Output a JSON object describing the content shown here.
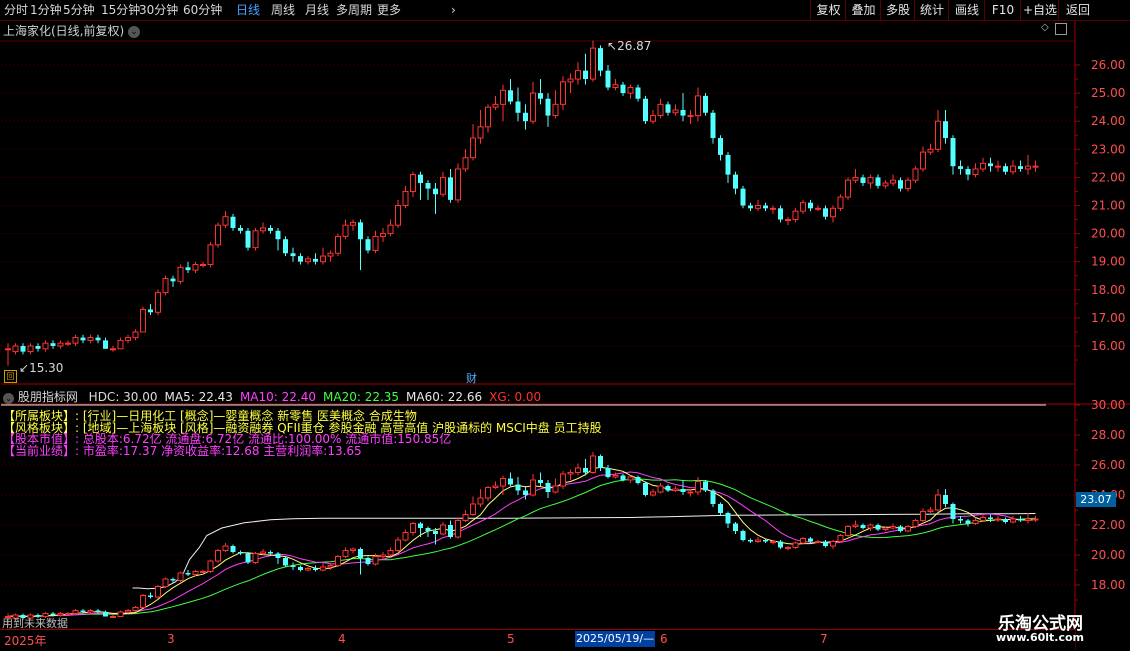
{
  "toolbar": {
    "periods": [
      "分时",
      "1分钟",
      "5分钟",
      "15分钟",
      "30分钟",
      "60分钟",
      "日线",
      "周线",
      "月线",
      "多周期",
      "更多"
    ],
    "active_period": "日线",
    "right_buttons": [
      "复权",
      "叠加",
      "多股",
      "统计",
      "画线",
      "F10",
      "+自选",
      "返回"
    ],
    "mark_label": "标记"
  },
  "main_panel": {
    "title": "上海家化(日线,前复权)",
    "high_label": "26.87",
    "low_label": "15.30",
    "fin_marker": "财",
    "y_ticks": [
      "26.00",
      "25.00",
      "24.00",
      "23.00",
      "22.00",
      "21.00",
      "20.00",
      "19.00",
      "18.00",
      "17.00",
      "16.00"
    ]
  },
  "indicator_panel": {
    "name": "股朋指标网",
    "readouts": [
      {
        "label": "HDC: 30.00",
        "color": "#dcdcdc"
      },
      {
        "label": "MA5: 22.43",
        "color": "#e8e8e8"
      },
      {
        "label": "MA10: 22.40",
        "color": "#ff40ff"
      },
      {
        "label": "MA20: 22.35",
        "color": "#40ff40"
      },
      {
        "label": "MA60: 22.66",
        "color": "#e8e8e8"
      },
      {
        "label": "XG: 0.00",
        "color": "#ff3030"
      }
    ],
    "info_lines": [
      {
        "text": "【所属板块】: [行业]—日用化工 [概念]—婴童概念 新零售 医美概念 合成生物",
        "color": "#ffff40"
      },
      {
        "text": "【风格板块】: [地域]—上海板块 [风格]—融资融券 QFII重仓 参股金融 高营高值 沪股通标的 MSCI中盘 员工持股",
        "color": "#ffff40"
      },
      {
        "text": "【股本市值】: 总股本:6.72亿 流通盘:6.72亿 流通比:100.00% 流通市值:150.85亿",
        "color": "#ff40ff"
      },
      {
        "text": "【当前业绩】: 市盈率:17.37 净资收益率:12.68 主营利润率:13.65",
        "color": "#ff40ff"
      }
    ],
    "current_price": "23.07",
    "y_ticks": [
      "30.00",
      "28.00",
      "26.00",
      "24.00",
      "22.00",
      "20.00",
      "18.00"
    ],
    "footer_note": "用到未来数据"
  },
  "time_axis": {
    "year": "2025年",
    "months": [
      "3",
      "4",
      "5",
      "6",
      "7"
    ],
    "cursor_date": "2025/05/19/—"
  },
  "watermark": {
    "site": "乐淘公式网",
    "url": "www.60lt.com"
  },
  "colors": {
    "up": "#ff3232",
    "down": "#54ffff",
    "axis": "#a00000",
    "grid": "#5a0000",
    "ma5": "#ffffff",
    "ma10": "#ff40ff",
    "ma20": "#40ff40",
    "ma60": "#ffffff",
    "price_box": "#0060a0"
  },
  "chart_data": {
    "type": "candlestick",
    "axis_range_main": [
      15.3,
      26.87
    ],
    "axis_range_indicator": [
      17.5,
      30
    ],
    "candles": [
      [
        15.9,
        15.9,
        16.1,
        15.3
      ],
      [
        15.8,
        16.0,
        16.1,
        15.7
      ],
      [
        16.0,
        15.8,
        16.1,
        15.7
      ],
      [
        15.8,
        16.0,
        16.1,
        15.7
      ],
      [
        16.0,
        15.9,
        16.1,
        15.8
      ],
      [
        15.9,
        16.1,
        16.2,
        15.8
      ],
      [
        16.1,
        16.0,
        16.2,
        15.9
      ],
      [
        16.0,
        16.1,
        16.2,
        15.9
      ],
      [
        16.1,
        16.1,
        16.2,
        16.0
      ],
      [
        16.1,
        16.3,
        16.4,
        16.0
      ],
      [
        16.3,
        16.2,
        16.4,
        16.1
      ],
      [
        16.2,
        16.3,
        16.4,
        16.1
      ],
      [
        16.3,
        16.2,
        16.4,
        16.1
      ],
      [
        16.2,
        15.9,
        16.3,
        15.9
      ],
      [
        15.9,
        15.9,
        16.0,
        15.8
      ],
      [
        15.9,
        16.2,
        16.3,
        15.9
      ],
      [
        16.2,
        16.3,
        16.4,
        16.1
      ],
      [
        16.3,
        16.5,
        16.6,
        16.2
      ],
      [
        16.5,
        17.3,
        17.4,
        16.5
      ],
      [
        17.3,
        17.2,
        17.5,
        17.1
      ],
      [
        17.2,
        17.9,
        18.0,
        17.1
      ],
      [
        17.9,
        18.4,
        18.5,
        17.8
      ],
      [
        18.4,
        18.3,
        18.5,
        18.1
      ],
      [
        18.3,
        18.8,
        18.9,
        18.2
      ],
      [
        18.8,
        18.7,
        19.0,
        18.6
      ],
      [
        18.7,
        18.9,
        19.0,
        18.6
      ],
      [
        18.9,
        18.9,
        19.0,
        18.8
      ],
      [
        18.9,
        19.6,
        19.7,
        18.8
      ],
      [
        19.6,
        20.3,
        20.4,
        19.5
      ],
      [
        20.3,
        20.6,
        20.8,
        20.2
      ],
      [
        20.6,
        20.2,
        20.7,
        20.1
      ],
      [
        20.2,
        20.1,
        20.3,
        20.0
      ],
      [
        20.1,
        19.5,
        20.2,
        19.4
      ],
      [
        19.5,
        20.1,
        20.2,
        19.4
      ],
      [
        20.1,
        20.2,
        20.4,
        20.0
      ],
      [
        20.2,
        20.1,
        20.3,
        20.0
      ],
      [
        20.1,
        19.8,
        20.2,
        19.4
      ],
      [
        19.8,
        19.3,
        19.9,
        19.2
      ],
      [
        19.3,
        19.2,
        19.5,
        19.0
      ],
      [
        19.2,
        19.0,
        19.3,
        18.9
      ],
      [
        19.0,
        19.1,
        19.2,
        18.9
      ],
      [
        19.1,
        19.0,
        19.3,
        18.9
      ],
      [
        19.0,
        19.2,
        19.5,
        18.9
      ],
      [
        19.2,
        19.3,
        19.4,
        19.0
      ],
      [
        19.3,
        19.9,
        20.0,
        19.2
      ],
      [
        19.9,
        20.3,
        20.5,
        19.8
      ],
      [
        20.3,
        20.4,
        20.5,
        20.1
      ],
      [
        20.4,
        19.8,
        20.5,
        18.7
      ],
      [
        19.8,
        19.4,
        19.9,
        19.3
      ],
      [
        19.4,
        19.9,
        20.1,
        19.3
      ],
      [
        19.9,
        20.0,
        20.2,
        19.7
      ],
      [
        20.0,
        20.3,
        20.5,
        19.9
      ],
      [
        20.3,
        21.0,
        21.2,
        20.2
      ],
      [
        21.0,
        21.5,
        21.7,
        20.9
      ],
      [
        21.5,
        22.1,
        22.2,
        21.3
      ],
      [
        22.1,
        21.8,
        22.2,
        21.2
      ],
      [
        21.8,
        21.6,
        21.9,
        21.2
      ],
      [
        21.6,
        21.4,
        21.8,
        20.7
      ],
      [
        21.4,
        22.0,
        22.2,
        21.3
      ],
      [
        22.0,
        21.2,
        22.3,
        21.1
      ],
      [
        21.2,
        22.3,
        22.5,
        21.1
      ],
      [
        22.3,
        22.7,
        23.0,
        22.2
      ],
      [
        22.7,
        23.4,
        23.9,
        22.6
      ],
      [
        23.4,
        23.8,
        24.4,
        23.2
      ],
      [
        23.8,
        24.5,
        24.6,
        23.6
      ],
      [
        24.5,
        24.6,
        24.9,
        24.4
      ],
      [
        24.6,
        25.1,
        25.3,
        24.0
      ],
      [
        25.1,
        24.7,
        25.5,
        24.6
      ],
      [
        24.7,
        24.3,
        25.2,
        24.0
      ],
      [
        24.3,
        24.0,
        24.6,
        23.7
      ],
      [
        24.0,
        25.0,
        25.4,
        23.9
      ],
      [
        25.0,
        24.8,
        25.5,
        24.6
      ],
      [
        24.8,
        24.2,
        25.0,
        23.8
      ],
      [
        24.2,
        24.6,
        25.1,
        24.1
      ],
      [
        24.6,
        25.4,
        25.6,
        24.4
      ],
      [
        25.4,
        25.5,
        25.7,
        25.0
      ],
      [
        25.5,
        25.8,
        26.1,
        25.3
      ],
      [
        25.8,
        25.5,
        26.4,
        25.3
      ],
      [
        25.5,
        26.6,
        26.87,
        25.4
      ],
      [
        26.6,
        25.8,
        26.7,
        25.6
      ],
      [
        25.8,
        25.2,
        26.0,
        25.1
      ],
      [
        25.2,
        25.3,
        25.5,
        25.1
      ],
      [
        25.3,
        25.0,
        25.4,
        24.9
      ],
      [
        25.0,
        25.2,
        25.3,
        24.8
      ],
      [
        25.2,
        24.8,
        25.3,
        24.7
      ],
      [
        24.8,
        24.0,
        24.9,
        23.9
      ],
      [
        24.0,
        24.2,
        24.4,
        23.9
      ],
      [
        24.2,
        24.6,
        24.8,
        24.1
      ],
      [
        24.6,
        24.3,
        24.7,
        24.2
      ],
      [
        24.3,
        24.4,
        24.6,
        24.2
      ],
      [
        24.4,
        24.2,
        25.0,
        24.0
      ],
      [
        24.2,
        24.2,
        24.4,
        23.9
      ],
      [
        24.2,
        24.9,
        25.2,
        24.0
      ],
      [
        24.9,
        24.3,
        25.0,
        24.2
      ],
      [
        24.3,
        23.4,
        24.4,
        23.2
      ],
      [
        23.4,
        22.8,
        23.5,
        22.6
      ],
      [
        22.8,
        22.1,
        22.9,
        21.8
      ],
      [
        22.1,
        21.6,
        22.2,
        21.4
      ],
      [
        21.6,
        21.0,
        21.7,
        20.9
      ],
      [
        21.0,
        20.9,
        21.1,
        20.8
      ],
      [
        20.9,
        21.0,
        21.2,
        20.8
      ],
      [
        21.0,
        20.9,
        21.1,
        20.8
      ],
      [
        20.9,
        20.9,
        21.0,
        20.7
      ],
      [
        20.9,
        20.5,
        21.0,
        20.4
      ],
      [
        20.5,
        20.5,
        20.6,
        20.3
      ],
      [
        20.5,
        20.8,
        20.9,
        20.4
      ],
      [
        20.8,
        21.1,
        21.2,
        20.7
      ],
      [
        21.1,
        20.9,
        21.2,
        20.8
      ],
      [
        20.9,
        20.9,
        21.0,
        20.8
      ],
      [
        20.9,
        20.6,
        21.0,
        20.5
      ],
      [
        20.6,
        20.9,
        21.0,
        20.4
      ],
      [
        20.9,
        21.3,
        21.4,
        20.8
      ],
      [
        21.3,
        21.9,
        22.0,
        21.2
      ],
      [
        21.9,
        22.0,
        22.3,
        21.8
      ],
      [
        22.0,
        21.8,
        22.1,
        21.7
      ],
      [
        21.8,
        22.0,
        22.1,
        21.6
      ],
      [
        22.0,
        21.7,
        22.1,
        21.6
      ],
      [
        21.7,
        21.8,
        21.9,
        21.6
      ],
      [
        21.8,
        21.9,
        22.1,
        21.7
      ],
      [
        21.9,
        21.6,
        22.0,
        21.5
      ],
      [
        21.6,
        21.9,
        22.0,
        21.5
      ],
      [
        21.9,
        22.3,
        22.4,
        21.8
      ],
      [
        22.3,
        22.9,
        23.1,
        22.2
      ],
      [
        22.9,
        23.0,
        23.2,
        22.8
      ],
      [
        23.0,
        24.0,
        24.4,
        22.9
      ],
      [
        24.0,
        23.4,
        24.4,
        23.2
      ],
      [
        23.4,
        22.4,
        23.5,
        22.1
      ],
      [
        22.4,
        22.3,
        22.6,
        22.1
      ],
      [
        22.3,
        22.1,
        22.4,
        21.9
      ],
      [
        22.1,
        22.3,
        22.5,
        22.0
      ],
      [
        22.3,
        22.5,
        22.7,
        22.2
      ],
      [
        22.5,
        22.4,
        22.7,
        22.2
      ],
      [
        22.4,
        22.4,
        22.6,
        22.2
      ],
      [
        22.4,
        22.2,
        22.5,
        22.1
      ],
      [
        22.2,
        22.4,
        22.6,
        22.1
      ],
      [
        22.4,
        22.3,
        22.6,
        22.2
      ],
      [
        22.3,
        22.4,
        22.8,
        22.1
      ],
      [
        22.4,
        22.4,
        22.6,
        22.2
      ]
    ],
    "ma60": [
      [
        16.6,
        17.8
      ],
      [
        17.4,
        17.8
      ],
      [
        18.6,
        17.75
      ],
      [
        19.9,
        17.78
      ],
      [
        21.1,
        17.9
      ],
      [
        22.3,
        18.2
      ],
      [
        23.3,
        18.7
      ],
      [
        24.2,
        19.7
      ],
      [
        25.5,
        20.5
      ],
      [
        26.5,
        21.3
      ],
      [
        28.5,
        21.8
      ],
      [
        31.5,
        22.15
      ],
      [
        35,
        22.35
      ],
      [
        38,
        22.42
      ],
      [
        42,
        22.45
      ],
      [
        45,
        22.45
      ],
      [
        52,
        22.45
      ],
      [
        59,
        22.45
      ],
      [
        66,
        22.45
      ],
      [
        77,
        22.48
      ],
      [
        83,
        22.5
      ],
      [
        86,
        22.53
      ],
      [
        88,
        22.55
      ],
      [
        92,
        22.6
      ],
      [
        96,
        22.65
      ],
      [
        100,
        22.66
      ],
      [
        104,
        22.67
      ],
      [
        110,
        22.68
      ],
      [
        116,
        22.7
      ],
      [
        122,
        22.72
      ],
      [
        128,
        22.75
      ],
      [
        134,
        22.75
      ],
      [
        137,
        22.77
      ]
    ]
  }
}
